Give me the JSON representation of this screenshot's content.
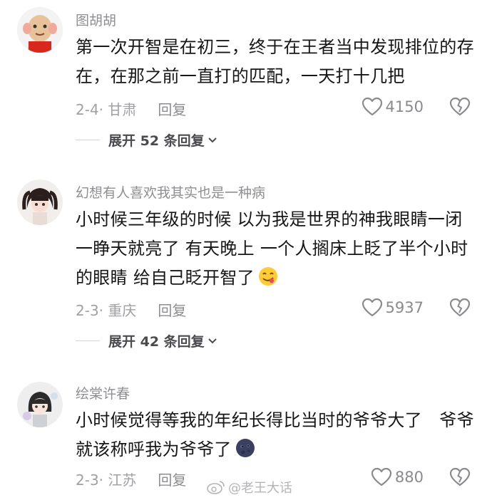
{
  "comments": [
    {
      "username": "图胡胡",
      "text": "第一次开智是在初三，终于在王者当中发现排位的存在，在那之前一直打的匹配，一天打十几把",
      "meta": "2-4· 甘肃",
      "reply_label": "回复",
      "likes": "4150",
      "expand_label": "展开 52 条回复"
    },
    {
      "username": "幻想有人喜欢我其实也是一种病",
      "text": "小时候三年级的时候 以为我是世界的神我眼睛一闭一睁天就亮了 有天晚上 一个人搁床上眨了半个小时的眼睛 给自己眨开智了",
      "meta": "2-3· 重庆",
      "reply_label": "回复",
      "likes": "5937",
      "expand_label": "展开 42 条回复"
    },
    {
      "username": "绘棠许春",
      "text": "小时候觉得等我的年纪长得比当时的爷爷大了　爷爷就该称呼我为爷爷了",
      "meta": "2-3· 江苏",
      "reply_label": "回复",
      "likes": "880"
    }
  ],
  "watermark": "@老王大话",
  "icons": [
    "avatar",
    "heart-outline-icon",
    "broken-heart-icon",
    "chevron-down-icon",
    "yummy-face-emoji",
    "new-moon-face-emoji",
    "weibo-logo-icon"
  ]
}
